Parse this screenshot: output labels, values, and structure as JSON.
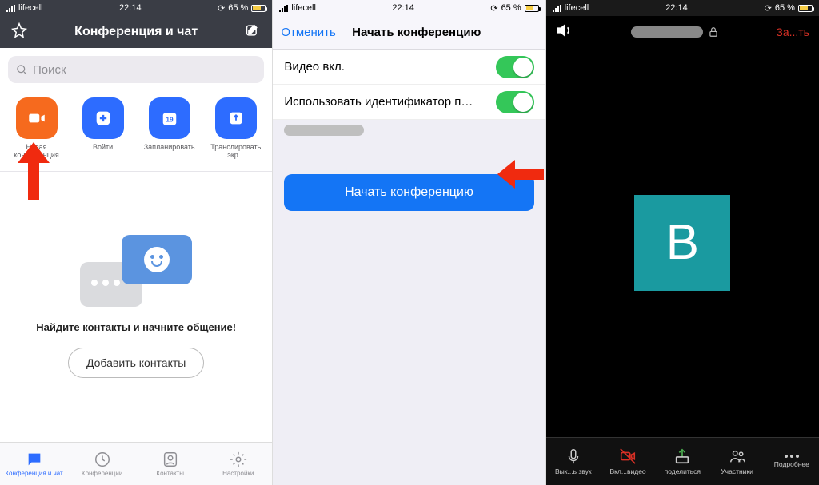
{
  "status": {
    "carrier": "lifecell",
    "time": "22:14",
    "battery": "65 %"
  },
  "screen1": {
    "title": "Конференция и чат",
    "search_placeholder": "Поиск",
    "actions": {
      "new_meeting": "Новая конференция",
      "join": "Войти",
      "schedule": "Запланировать",
      "share": "Транслировать экр..."
    },
    "empty_msg": "Найдите контакты и начните общение!",
    "add_contacts": "Добавить контакты",
    "tabs": {
      "chat": "Конференция и чат",
      "meetings": "Конференции",
      "contacts": "Контакты",
      "settings": "Настройки"
    }
  },
  "screen2": {
    "cancel": "Отменить",
    "title": "Начать конференцию",
    "video_on": "Видео вкл.",
    "use_pmi": "Использовать идентификатор перс...",
    "start_meeting": "Начать конференцию"
  },
  "screen3": {
    "end": "За...ть",
    "avatar_letter": "В",
    "controls": {
      "mute": "Вык...ь звук",
      "video": "Вкл...видео",
      "share": "поделиться",
      "participants": "Участники",
      "more": "Подробнее"
    }
  }
}
